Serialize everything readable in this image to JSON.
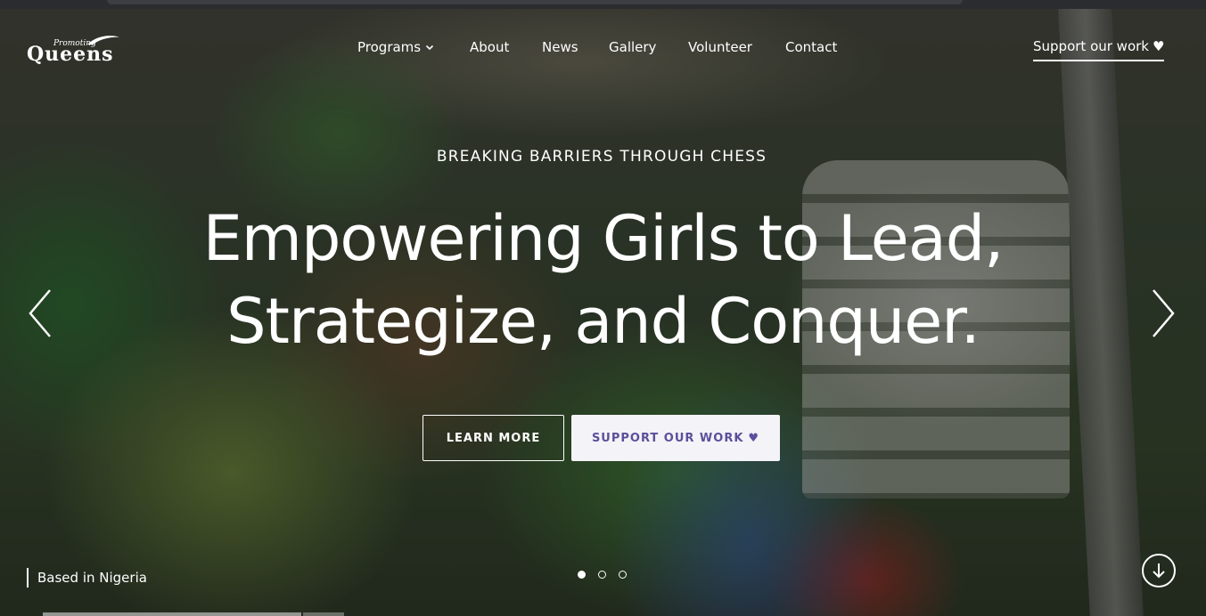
{
  "brand": {
    "logo_small": "Promoting",
    "logo_big": "Queens"
  },
  "nav": {
    "items": [
      {
        "label": "Programs",
        "has_dropdown": true
      },
      {
        "label": "About"
      },
      {
        "label": "News"
      },
      {
        "label": "Gallery"
      },
      {
        "label": "Volunteer"
      },
      {
        "label": "Contact"
      }
    ],
    "support_label": "Support our work",
    "support_icon": "heart-icon"
  },
  "hero": {
    "eyebrow": "BREAKING BARRIERS THROUGH CHESS",
    "headline_line1": "Empowering Girls to Lead,",
    "headline_line2": "Strategize, and Conquer.",
    "learn_more_label": "LEARN MORE",
    "support_button_label": "SUPPORT OUR WORK",
    "location": "Based in Nigeria",
    "slides_total": 3,
    "active_slide": 1
  },
  "icons": {
    "prev": "chevron-left-icon",
    "next": "chevron-right-icon",
    "scroll": "arrow-down-icon",
    "heart": "heart-icon"
  },
  "colors": {
    "accent_purple": "#5c4f9c",
    "button_light": "#f4f3f7"
  }
}
